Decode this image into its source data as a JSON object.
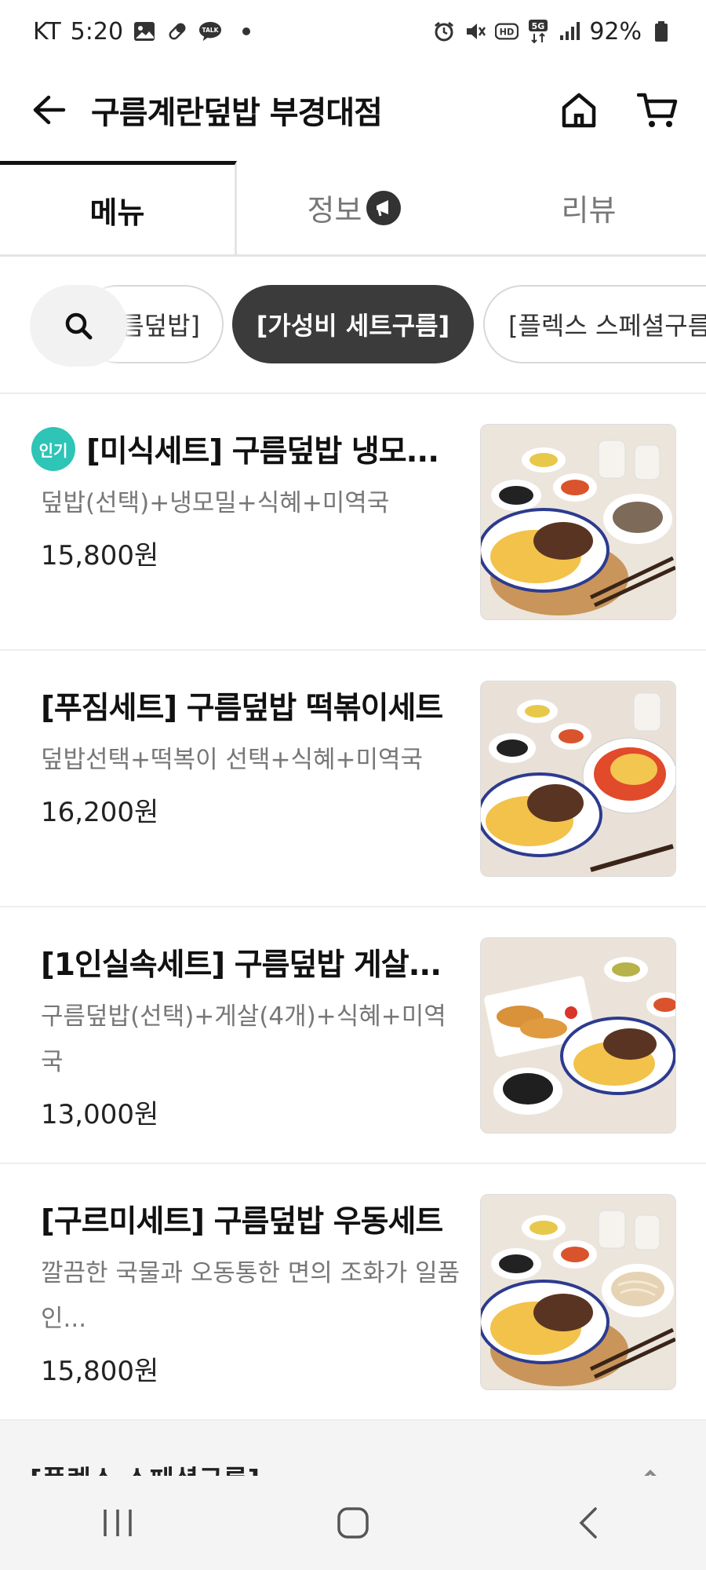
{
  "status_bar": {
    "carrier": "KT",
    "time": "5:20",
    "battery": "92%",
    "left_icons": [
      "gallery-icon",
      "pill-icon",
      "talk-icon"
    ],
    "right_icons": [
      "alarm-icon",
      "mute-icon",
      "hd-icon",
      "5g-icon",
      "signal-icon",
      "battery-icon"
    ],
    "talk_label": "TALK",
    "hd_label": "HD",
    "fiveg_label": "5G"
  },
  "header": {
    "title": "구름계란덮밥 부경대점",
    "back_icon": "back-arrow-icon",
    "home_icon": "home-icon",
    "cart_icon": "cart-icon"
  },
  "tabs": [
    {
      "label": "메뉴",
      "active": true
    },
    {
      "label": "정보",
      "active": false
    },
    {
      "label": "리뷰",
      "active": false
    }
  ],
  "category_chips": {
    "prev": "름덮밥]",
    "active": "[가성비 세트구름]",
    "next": "[플렉스 스페셜구름"
  },
  "menu_items": [
    {
      "name": "[미식세트] 구름덮밥 냉모...",
      "badge": "인기",
      "description": "덮밥(선택)+냉모밀+식혜+미역국",
      "price": "15,800원"
    },
    {
      "name": "[푸짐세트] 구름덮밥 떡볶이세트",
      "description": "덮밥선택+떡복이 선택+식혜+미역국",
      "price": "16,200원"
    },
    {
      "name": "[1인실속세트] 구름덮밥 게살...",
      "description": "구름덮밥(선택)+게살(4개)+식혜+미역국",
      "price": "13,000원"
    },
    {
      "name": "[구르미세트] 구름덮밥 우동세트",
      "description": "깔끔한 국물과 오동통한 면의 조화가 일품인...",
      "price": "15,800원"
    }
  ],
  "section": {
    "title": "[플렉스 스페셜구름]"
  },
  "nav_bar": {
    "recent_icon": "recent-apps-icon",
    "home_icon": "home-nav-icon",
    "back_icon": "back-nav-icon"
  },
  "colors": {
    "accent_dark": "#3b3b3b",
    "popular_badge": "#2ec4b6",
    "text_primary": "#111111",
    "text_secondary": "#777777"
  }
}
